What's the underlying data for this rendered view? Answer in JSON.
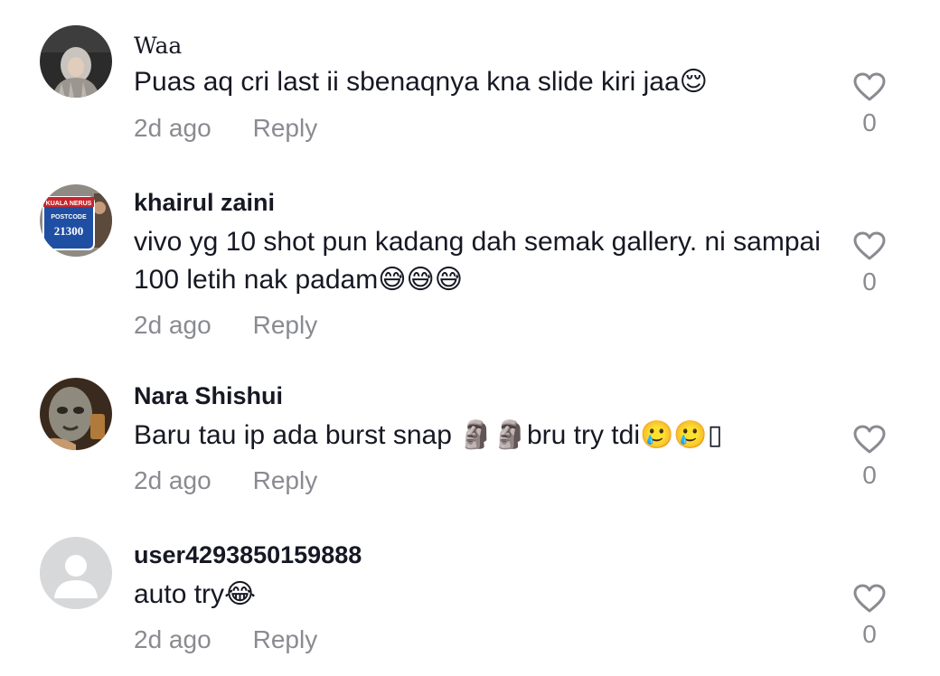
{
  "comments": [
    {
      "username": "Waa",
      "text": "Puas aq cri last ii sbenaqnya kna slide kiri jaa😌",
      "time": "2d ago",
      "reply": "Reply",
      "likes": "0",
      "avatar": "profile-photo-hijab"
    },
    {
      "username": "khairul zaini",
      "text": "vivo yg 10 shot pun kadang dah semak gallery. ni sampai 100 letih nak padam😅😅😅",
      "time": "2d ago",
      "reply": "Reply",
      "likes": "0",
      "avatar": "profile-photo-postcode-sign",
      "avatar_sign_top": "KUALA NERUS",
      "avatar_sign_mid": "POSTCODE",
      "avatar_sign_code": "21300"
    },
    {
      "username": "Nara Shishui",
      "text": "Baru tau ip ada burst snap 🗿🗿bru try tdi🥲🥲▯",
      "time": "2d ago",
      "reply": "Reply",
      "likes": "0",
      "avatar": "profile-photo-mask"
    },
    {
      "username": "user4293850159888",
      "text": "auto try😂",
      "time": "2d ago",
      "reply": "Reply",
      "likes": "0",
      "avatar": "default-avatar"
    }
  ],
  "colors": {
    "text": "#161823",
    "secondary": "#8a8b91",
    "icon": "#8a8b91"
  }
}
